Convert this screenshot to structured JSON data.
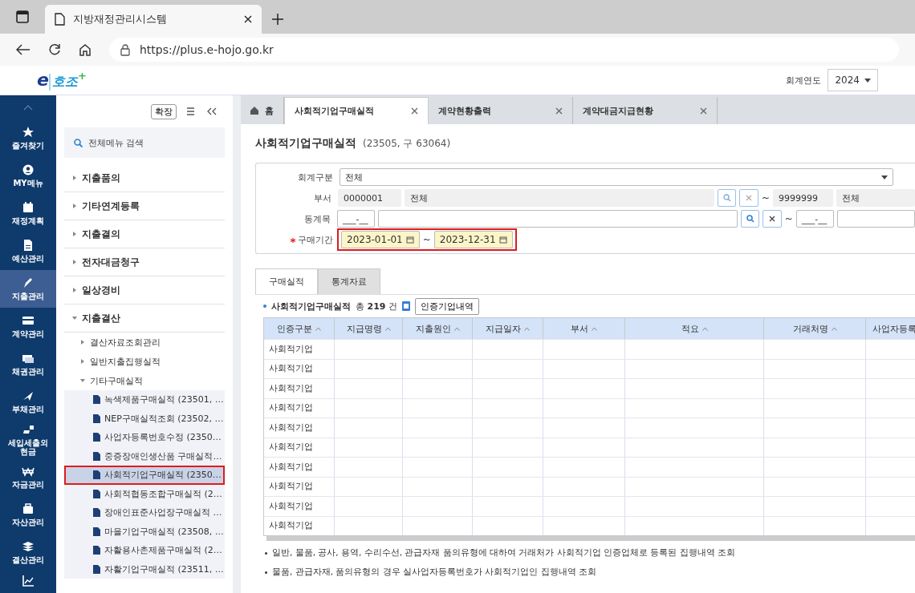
{
  "browser": {
    "tab_title": "지방재정관리시스템",
    "url": "https://plus.e-hojo.go.kr"
  },
  "header": {
    "logo": {
      "mark": "e",
      "name": "호조",
      "sup": "+"
    },
    "year_label": "회계연도",
    "year_value": "2024"
  },
  "rail": [
    {
      "label": "즐겨찾기",
      "selected": false
    },
    {
      "label": "MY메뉴",
      "selected": false
    },
    {
      "label": "재정계획",
      "selected": false
    },
    {
      "label": "예산관리",
      "selected": false
    },
    {
      "label": "지출관리",
      "selected": true
    },
    {
      "label": "계약관리",
      "selected": false
    },
    {
      "label": "채권관리",
      "selected": false
    },
    {
      "label": "부채관리",
      "selected": false
    },
    {
      "label": "세입세출외현금",
      "selected": false
    },
    {
      "label": "자금관리",
      "selected": false
    },
    {
      "label": "자산관리",
      "selected": false
    },
    {
      "label": "결산관리",
      "selected": false
    }
  ],
  "menu": {
    "expand_button": "확장",
    "search_placeholder": "전체메뉴 검색",
    "items": [
      {
        "label": "지출품의",
        "expanded": false
      },
      {
        "label": "기타연계등록",
        "expanded": false
      },
      {
        "label": "지출결의",
        "expanded": false
      },
      {
        "label": "전자대금청구",
        "expanded": false
      },
      {
        "label": "일상경비",
        "expanded": false
      },
      {
        "label": "지출결산",
        "expanded": true,
        "children": [
          {
            "label": "결산자료조회관리",
            "expanded": false
          },
          {
            "label": "일반지출집행실적",
            "expanded": false
          },
          {
            "label": "기타구매실적",
            "expanded": true,
            "children": [
              {
                "label": "녹색제품구매실적 (23501, …",
                "selected": false
              },
              {
                "label": "NEP구매실적조회 (23502, …",
                "selected": false
              },
              {
                "label": "사업자등록번호수정 (2350…",
                "selected": false
              },
              {
                "label": "중증장애인생산품 구매실적…",
                "selected": false
              },
              {
                "label": "사회적기업구매실적 (2350…",
                "selected": true
              },
              {
                "label": "사회적협동조합구매실적 (2…",
                "selected": false
              },
              {
                "label": "장애인표준사업장구매실적 …",
                "selected": false
              },
              {
                "label": "마을기업구매실적 (23508, …",
                "selected": false
              },
              {
                "label": "자활용사촌제품구매실적 (2…",
                "selected": false
              },
              {
                "label": "자활기업구매실적 (23511, …",
                "selected": false
              }
            ]
          }
        ]
      }
    ]
  },
  "tabs": [
    {
      "label": "홈",
      "kind": "home",
      "selected": false
    },
    {
      "label": "사회적기업구매실적",
      "kind": "page",
      "selected": true
    },
    {
      "label": "계약현황출력",
      "kind": "page",
      "selected": false
    },
    {
      "label": "계약대금지급현황",
      "kind": "page",
      "selected": false
    }
  ],
  "page": {
    "title": "사회적기업구매실적",
    "code": "(23505, 구 63064)"
  },
  "form": {
    "account_label": "회계구분",
    "account_value": "전체",
    "dept_label": "부서",
    "dept_from_code": "0000001",
    "dept_from_name": "전체",
    "dept_to_code": "9999999",
    "dept_to_name": "전체",
    "item_label": "동계목",
    "item_from_mask": "___-__",
    "item_to_mask": "___-__",
    "period_label": "구매기간",
    "period_required": true,
    "period_from": "2023-01-01",
    "period_to": "2023-12-31",
    "tilde": "~"
  },
  "subtabs": [
    {
      "label": "구매실적",
      "selected": true
    },
    {
      "label": "통계자료",
      "selected": false
    }
  ],
  "grid": {
    "title": "사회적기업구매실적",
    "count_prefix": "총",
    "count": "219",
    "count_suffix": "건",
    "button": "인증기업내역",
    "columns": [
      "인증구분",
      "지급명령",
      "지출원인",
      "지급일자",
      "부서",
      "적요",
      "거래처명",
      "사업자등록"
    ],
    "rows": [
      [
        "사회적기업"
      ],
      [
        "사회적기업"
      ],
      [
        "사회적기업"
      ],
      [
        "사회적기업"
      ],
      [
        "사회적기업"
      ],
      [
        "사회적기업"
      ],
      [
        "사회적기업"
      ],
      [
        "사회적기업"
      ],
      [
        "사회적기업"
      ],
      [
        "사회적기업"
      ]
    ]
  },
  "notes": [
    "일반, 물품, 공사, 용역, 수리수선, 관급자재 품의유형에 대하여 거래처가 사회적기업 인증업체로 등록된 집행내역 조회",
    "물품, 관급자재, 품의유형의 경우 실사업자등록번호가 사회적기업인 집행내역 조회"
  ]
}
